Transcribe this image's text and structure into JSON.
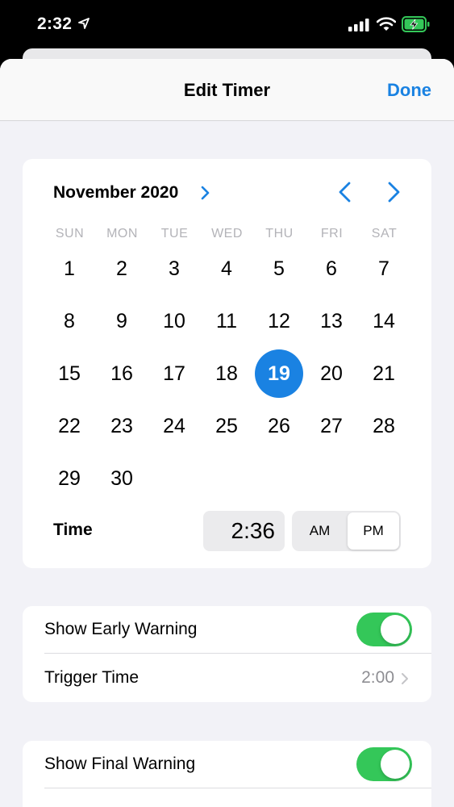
{
  "status_bar": {
    "time": "2:32"
  },
  "nav": {
    "title": "Edit Timer",
    "done_label": "Done"
  },
  "calendar": {
    "month_label": "November 2020",
    "weekdays": [
      "SUN",
      "MON",
      "TUE",
      "WED",
      "THU",
      "FRI",
      "SAT"
    ],
    "days": [
      "1",
      "2",
      "3",
      "4",
      "5",
      "6",
      "7",
      "8",
      "9",
      "10",
      "11",
      "12",
      "13",
      "14",
      "15",
      "16",
      "17",
      "18",
      "19",
      "20",
      "21",
      "22",
      "23",
      "24",
      "25",
      "26",
      "27",
      "28",
      "29",
      "30"
    ],
    "selected_day": "19",
    "time_label": "Time",
    "time_value": "2:36",
    "am_label": "AM",
    "pm_label": "PM",
    "selected_period": "PM"
  },
  "early_warning": {
    "show_label": "Show Early Warning",
    "show_enabled": true,
    "trigger_label": "Trigger Time",
    "trigger_value": "2:00"
  },
  "final_warning": {
    "show_label": "Show Final Warning",
    "show_enabled": true
  },
  "colors": {
    "accent": "#1a82e2",
    "toggle_on": "#34c759",
    "background": "#f2f2f7"
  }
}
